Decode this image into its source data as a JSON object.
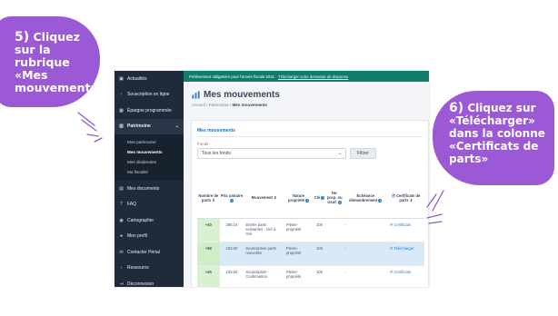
{
  "callouts": {
    "left": {
      "step": "5)",
      "text": "Cliquez sur la rubrique «Mes mouvements»"
    },
    "right": {
      "step": "6)",
      "text": "Cliquez sur «Télécharger» dans la colonne «Certificats de parts»"
    }
  },
  "colors": {
    "callout": "#9b59d6",
    "sidebar": "#1f2a3a",
    "banner": "#0f7c6c",
    "accent": "#2e7cc4",
    "highlight_row": "#d8e9f8",
    "parts_cell": "#d8f2d0"
  },
  "sidebar": {
    "items": [
      {
        "icon": "news-icon",
        "label": "Actualités"
      },
      {
        "icon": "chevron-left-icon",
        "label": "Souscription en ligne"
      },
      {
        "icon": "calendar-icon",
        "label": "Épargne programmée"
      },
      {
        "icon": "chart-icon",
        "label": "Patrimoine"
      }
    ],
    "patrimoine_sub": [
      "Mon patrimoine",
      "Mes mouvements",
      "Mes dividendes",
      "Ma fiscalité"
    ],
    "items_after": [
      {
        "icon": "docs-icon",
        "label": "Mes documents"
      },
      {
        "icon": "question-icon",
        "label": "FAQ"
      },
      {
        "icon": "map-icon",
        "label": "Cartographie"
      },
      {
        "icon": "user-icon",
        "label": "Mon profil"
      },
      {
        "icon": "mail-icon",
        "label": "Contacter Périal"
      },
      {
        "icon": "chevron-left-icon",
        "label": "Ressource"
      },
      {
        "icon": "logout-icon",
        "label": "Déconnexion"
      }
    ]
  },
  "banner": {
    "text": "Prélèvement obligatoire pour l'année fiscale 2021",
    "link": "Télécharger votre demande de dispense"
  },
  "header": {
    "title": "Mes mouvements",
    "breadcrumb": [
      "Accueil",
      "Patrimoine"
    ],
    "breadcrumb_current": "Mes mouvements"
  },
  "card": {
    "title": "Mes mouvements",
    "fonds_label": "Fonds :",
    "fonds_value": "Tous les fonds",
    "filter_button": "Filtrer"
  },
  "table": {
    "headers": [
      "Nombre de parts",
      "Prix unitaire",
      "Mouvement",
      "Nature propriété",
      "Clé",
      "Nu-prop. ou Usuf.",
      "Échéance démembrement",
      "Certificats de parts"
    ],
    "rows": [
      {
        "parts": "+40",
        "prix": "395.10",
        "mouvement": "Entrée parts existantes - Gré à Gré",
        "nature": "Pleine-propriété",
        "cle": "100",
        "nuprop": "",
        "echeance": "-",
        "cert": "Certificats",
        "highlight": false
      },
      {
        "parts": "+98",
        "prix": "192.00",
        "mouvement": "Souscription parts nouvelles",
        "nature": "Pleine-propriété",
        "cle": "100",
        "nuprop": "",
        "echeance": "-",
        "cert": "Télécharger",
        "highlight": true
      },
      {
        "parts": "+45",
        "prix": "233.50",
        "mouvement": "Souscription - Confirmation",
        "nature": "Pleine-propriété",
        "cle": "100",
        "nuprop": "",
        "echeance": "-",
        "cert": "Certificats",
        "highlight": false
      }
    ]
  }
}
